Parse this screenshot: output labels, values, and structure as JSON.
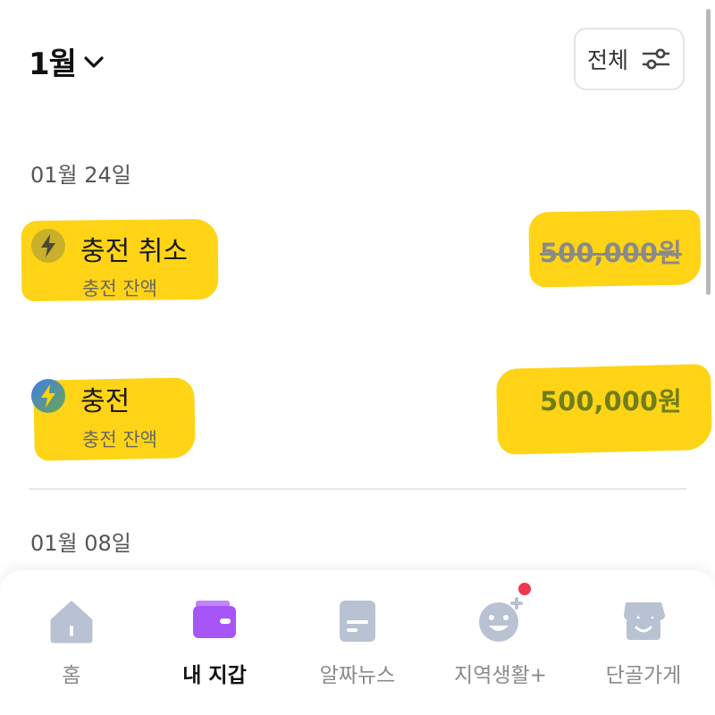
{
  "header": {
    "month": "1월",
    "filter_label": "전체"
  },
  "sections": [
    {
      "date": "01월 24일",
      "transactions": [
        {
          "title": "충전 취소",
          "subtitle": "충전 잔액",
          "amount": "500,000원",
          "status": "cancelled"
        },
        {
          "title": "충전",
          "subtitle": "충전 잔액",
          "amount": "500,000원",
          "status": "completed"
        }
      ]
    },
    {
      "date": "01월 08일",
      "transactions": []
    }
  ],
  "bottom_nav": {
    "items": [
      {
        "label": "홈",
        "icon": "home-icon",
        "active": false
      },
      {
        "label": "내 지갑",
        "icon": "wallet-icon",
        "active": true
      },
      {
        "label": "알짜뉴스",
        "icon": "news-icon",
        "active": false
      },
      {
        "label": "지역생활+",
        "icon": "smile-plus-icon",
        "active": false,
        "notification": true
      },
      {
        "label": "단골가게",
        "icon": "store-icon",
        "active": false
      }
    ]
  },
  "colors": {
    "highlight": "#ffd20a",
    "active_amount": "#6f7e1a",
    "wallet_purple": "#a855f7",
    "inactive_icon": "#b8c2d2",
    "notification_dot": "#f0364b"
  }
}
